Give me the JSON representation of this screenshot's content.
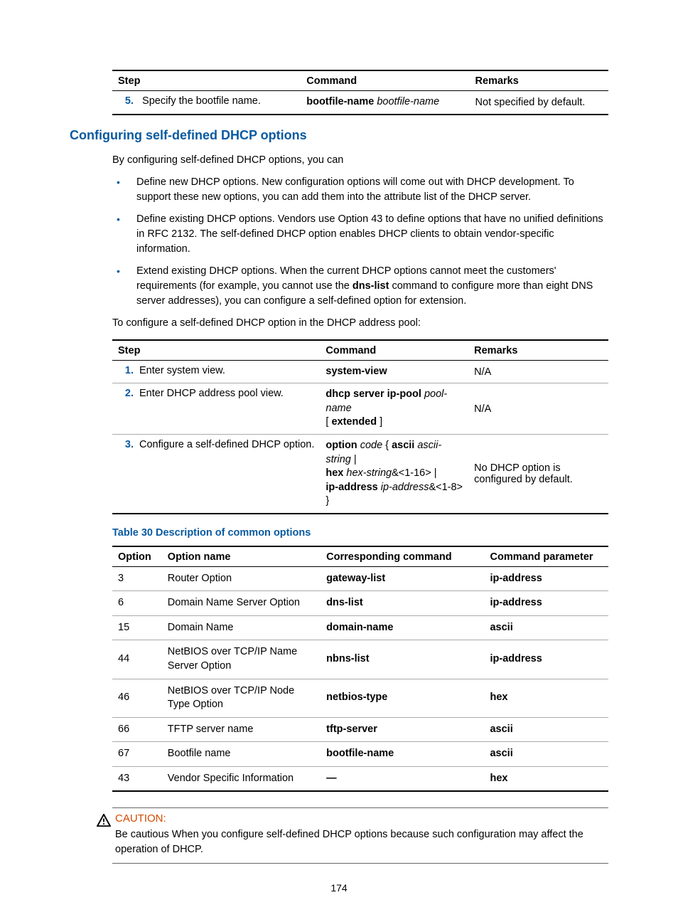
{
  "table1": {
    "headers": [
      "Step",
      "Command",
      "Remarks"
    ],
    "rows": [
      {
        "num": "5.",
        "step": "Specify the bootfile name.",
        "cmd_bold": "bootfile-name",
        "cmd_ital": "bootfile-name",
        "remark": "Not specified by default."
      }
    ]
  },
  "heading": "Configuring self-defined DHCP options",
  "intro": "By configuring self-defined DHCP options, you can",
  "bullets": [
    "Define new DHCP options. New configuration options will come out with DHCP development. To support these new options, you can add them into the attribute list of the DHCP server.",
    "Define existing DHCP options. Vendors use Option 43 to define options that have no unified definitions in RFC 2132. The self-defined DHCP option enables DHCP clients to obtain vendor-specific information.",
    {
      "pre": "Extend existing DHCP options. When the current DHCP options cannot meet the customers' requirements (for example, you cannot use the ",
      "bold": "dns-list",
      "post": " command to configure more than eight DNS server addresses), you can configure a self-defined option for extension."
    }
  ],
  "lead2": "To configure a self-defined DHCP option in the DHCP address pool:",
  "table2": {
    "headers": [
      "Step",
      "Command",
      "Remarks"
    ],
    "rows": [
      {
        "num": "1.",
        "step": "Enter system view.",
        "cmd_plain": "system-view",
        "remark": "N/A"
      },
      {
        "num": "2.",
        "step": "Enter DHCP address pool view.",
        "cmd_b1": "dhcp server ip-pool",
        "cmd_i1": "pool-name",
        "cmd_lb": "[ ",
        "cmd_b2": "extended",
        "cmd_rb": " ]",
        "remark": "N/A"
      },
      {
        "num": "3.",
        "step": "Configure a self-defined DHCP option.",
        "l1_b1": "option",
        "l1_i1": "code",
        "l1_t1": " { ",
        "l1_b2": "ascii",
        "l1_i2": "ascii-string",
        "l1_t2": " | ",
        "l2_b1": "hex",
        "l2_i1": "hex-string",
        "l2_t1": "&<1-16> | ",
        "l3_b1": "ip-address",
        "l3_i1": "ip-address",
        "l3_t1": "&<1-8> }",
        "remark": "No DHCP option is configured by default."
      }
    ]
  },
  "table3_caption": "Table 30 Description of common options",
  "table3": {
    "headers": [
      "Option",
      "Option name",
      "Corresponding command",
      "Command parameter"
    ],
    "rows": [
      {
        "opt": "3",
        "name": "Router Option",
        "cmd": "gateway-list",
        "param": "ip-address"
      },
      {
        "opt": "6",
        "name": "Domain Name Server Option",
        "cmd": "dns-list",
        "param": "ip-address"
      },
      {
        "opt": "15",
        "name": "Domain Name",
        "cmd": "domain-name",
        "param": "ascii"
      },
      {
        "opt": "44",
        "name": "NetBIOS over TCP/IP Name Server Option",
        "cmd": "nbns-list",
        "param": "ip-address"
      },
      {
        "opt": "46",
        "name": "NetBIOS over TCP/IP Node Type Option",
        "cmd": "netbios-type",
        "param": "hex"
      },
      {
        "opt": "66",
        "name": "TFTP server name",
        "cmd": "tftp-server",
        "param": "ascii"
      },
      {
        "opt": "67",
        "name": "Bootfile name",
        "cmd": "bootfile-name",
        "param": "ascii"
      },
      {
        "opt": "43",
        "name": "Vendor Specific Information",
        "cmd": "—",
        "param": "hex"
      }
    ]
  },
  "caution": {
    "heading": "CAUTION:",
    "text": "Be cautious When you configure self-defined DHCP options because such configuration may affect the operation of DHCP."
  },
  "page_number": "174"
}
